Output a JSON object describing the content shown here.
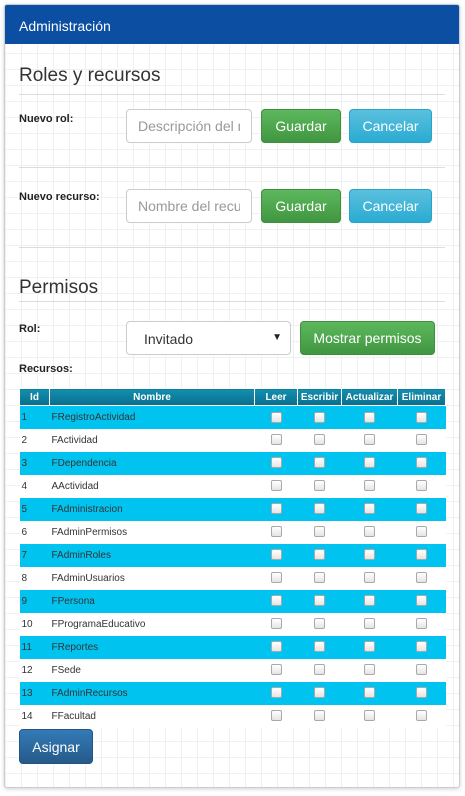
{
  "header": {
    "title": "Administración"
  },
  "roles": {
    "title": "Roles y recursos",
    "new_role_label": "Nuevo rol:",
    "new_role_placeholder": "Descripción del rol",
    "new_resource_label": "Nuevo recurso:",
    "new_resource_placeholder": "Nombre del recurso",
    "save_label": "Guardar",
    "cancel_label": "Cancelar"
  },
  "permissions": {
    "title": "Permisos",
    "role_label": "Rol:",
    "role_selected": "Invitado",
    "show_button": "Mostrar permisos",
    "resources_label": "Recursos:",
    "assign_button": "Asignar",
    "columns": [
      "Id",
      "Nombre",
      "Leer",
      "Escribir",
      "Actualizar",
      "Eliminar"
    ],
    "rows": [
      {
        "id": "1",
        "name": "FRegistroActividad"
      },
      {
        "id": "2",
        "name": "FActividad"
      },
      {
        "id": "3",
        "name": "FDependencia"
      },
      {
        "id": "4",
        "name": "AActividad"
      },
      {
        "id": "5",
        "name": "FAdministracion"
      },
      {
        "id": "6",
        "name": "FAdminPermisos"
      },
      {
        "id": "7",
        "name": "FAdminRoles"
      },
      {
        "id": "8",
        "name": "FAdminUsuarios"
      },
      {
        "id": "9",
        "name": "FPersona"
      },
      {
        "id": "10",
        "name": "FProgramaEducativo"
      },
      {
        "id": "11",
        "name": "FReportes"
      },
      {
        "id": "12",
        "name": "FSede"
      },
      {
        "id": "13",
        "name": "FAdminRecursos"
      },
      {
        "id": "14",
        "name": "FFacultad"
      }
    ]
  },
  "colors": {
    "header": "#0b4ea2",
    "row_highlight": "#00c4ef",
    "success": "#5cb85c",
    "info": "#5bc0de",
    "primary": "#337ab7"
  }
}
